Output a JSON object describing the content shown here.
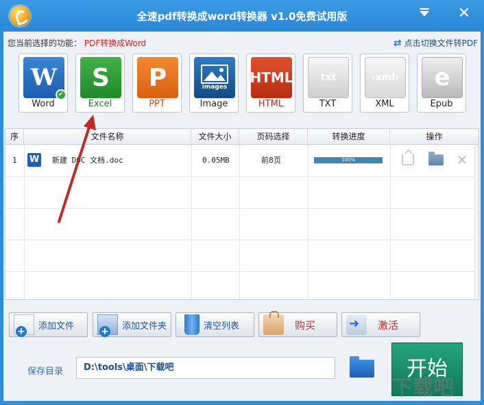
{
  "window": {
    "title": "全速pdf转换成word转换器 v1.0免费试用版",
    "minimize_glyph": "▼",
    "close_glyph": "✕"
  },
  "function_bar": {
    "label": "您当前选择的功能：",
    "value": "PDF转换成Word",
    "switch_link": "点击切换文件转PDF",
    "switch_icon": "⇄"
  },
  "formats": [
    {
      "label": "Word",
      "glyph": "W",
      "selected": true
    },
    {
      "label": "Excel",
      "glyph": "S"
    },
    {
      "label": "PPT",
      "glyph": "P"
    },
    {
      "label": "Image",
      "glyph": "images"
    },
    {
      "label": "HTML",
      "glyph": "HTML"
    },
    {
      "label": "TXT",
      "glyph": "txt"
    },
    {
      "label": "XML",
      "glyph": "‹xml›"
    },
    {
      "label": "Epub",
      "glyph": "e"
    }
  ],
  "table": {
    "headers": [
      "序",
      "文件名称",
      "文件大小",
      "页码选择",
      "转换进度",
      "操作"
    ],
    "rows": [
      {
        "index": "1",
        "file_icon": "W",
        "name": "新建 DOC 文档.doc",
        "size": "0.05MB",
        "pages": "前8页",
        "progress_text": "100%",
        "progress": 1.0
      }
    ]
  },
  "buttons": {
    "add_file": "添加文件",
    "add_folder": "添加文件夹",
    "clear_list": "清空列表",
    "buy": "购买",
    "activate": "激活"
  },
  "save": {
    "label": "保存目录",
    "path": "D:\\tools\\桌面\\下载吧"
  },
  "start_button": "开始",
  "watermark": "下载吧",
  "colors": {
    "titlebar": "#2d8fdc",
    "selected_function": "#e02020",
    "start_button": "#168f68",
    "annotation_arrow": "#c62828"
  }
}
